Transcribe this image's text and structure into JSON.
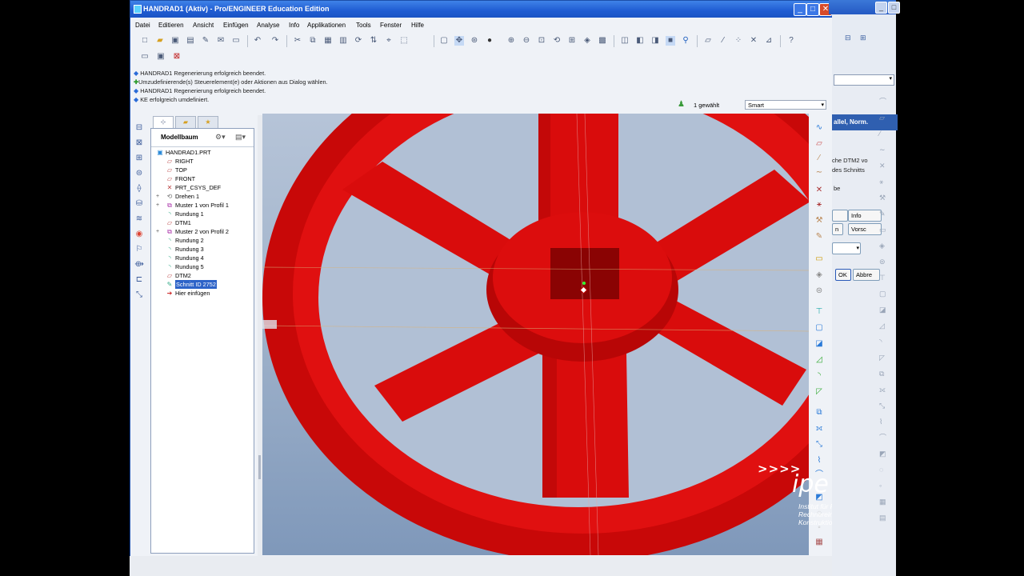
{
  "window": {
    "title": "HANDRAD1 (Aktiv) - Pro/ENGINEER Education Edition",
    "min": "_",
    "max": "□",
    "close": "✕"
  },
  "menu": [
    "Datei",
    "Editieren",
    "Ansicht",
    "Einfügen",
    "Analyse",
    "Info",
    "Applikationen",
    "Tools",
    "Fenster",
    "Hilfe"
  ],
  "messages": [
    "HANDRAD1 Regenerierung erfolgreich beendet.",
    "Umzudefinierende(s) Steuerelement(e) oder Aktionen aus Dialog wählen.",
    "HANDRAD1 Regenerierung erfolgreich beendet.",
    "KE erfolgreich umdefiniert."
  ],
  "selection": {
    "count": "1 gewählt",
    "filter": "Smart"
  },
  "tree": {
    "header": "Modellbaum",
    "items": [
      {
        "label": "HANDRAD1.PRT",
        "icon": "part-icon",
        "expand": false,
        "selected": false
      },
      {
        "label": "RIGHT",
        "icon": "datum-plane-icon",
        "expand": false,
        "selected": false
      },
      {
        "label": "TOP",
        "icon": "datum-plane-icon",
        "expand": false,
        "selected": false
      },
      {
        "label": "FRONT",
        "icon": "datum-plane-icon",
        "expand": false,
        "selected": false
      },
      {
        "label": "PRT_CSYS_DEF",
        "icon": "csys-icon",
        "expand": false,
        "selected": false
      },
      {
        "label": "Drehen 1",
        "icon": "revolve-icon",
        "expand": true,
        "selected": false
      },
      {
        "label": "Muster 1 von Profil 1",
        "icon": "pattern-icon",
        "expand": true,
        "selected": false
      },
      {
        "label": "Rundung 1",
        "icon": "round-icon",
        "expand": false,
        "selected": false
      },
      {
        "label": "DTM1",
        "icon": "datum-plane-icon",
        "expand": false,
        "selected": false
      },
      {
        "label": "Muster 2 von Profil 2",
        "icon": "pattern-icon",
        "expand": true,
        "selected": false
      },
      {
        "label": "Rundung 2",
        "icon": "round-icon",
        "expand": false,
        "selected": false
      },
      {
        "label": "Rundung 3",
        "icon": "round-icon",
        "expand": false,
        "selected": false
      },
      {
        "label": "Rundung 4",
        "icon": "round-icon",
        "expand": false,
        "selected": false
      },
      {
        "label": "Rundung 5",
        "icon": "round-icon",
        "expand": false,
        "selected": false
      },
      {
        "label": "DTM2",
        "icon": "datum-plane-icon",
        "expand": false,
        "selected": false
      },
      {
        "label": "Schnitt ID 2752",
        "icon": "sketch-icon",
        "expand": false,
        "selected": true
      },
      {
        "label": "Hier einfügen",
        "icon": "insert-arrow-icon",
        "expand": false,
        "selected": false
      }
    ]
  },
  "background_window": {
    "header": "allel, Norm.",
    "texts": [
      "che DTM2 vo",
      "des Schnitts",
      "be"
    ],
    "buttons": [
      "Info",
      "Vorsc",
      "OK",
      "Abbre",
      "n"
    ]
  },
  "watermark": {
    "arrows": ">>>>",
    "logo": "ipe",
    "line1": "Institut für Produkt Engineering",
    "line2": "Rechnereinsatz in der Konstruktion"
  },
  "colors": {
    "model_red": "#dd0b0b",
    "title_blue": "#2459c3",
    "selection_blue": "#2d63c8"
  }
}
